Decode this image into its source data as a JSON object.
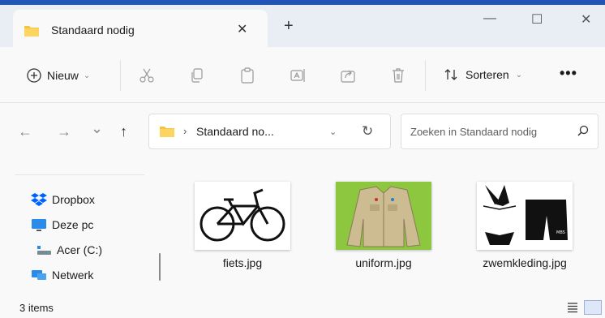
{
  "tab": {
    "title": "Standaard nodig",
    "close": "✕",
    "new_tab": "+"
  },
  "window_controls": {
    "minimize": "—",
    "maximize": "☐",
    "close": "✕"
  },
  "toolbar": {
    "new_label": "Nieuw",
    "sort_label": "Sorteren",
    "more_label": "•••",
    "icons": [
      "cut-icon",
      "copy-icon",
      "paste-icon",
      "rename-icon",
      "share-icon",
      "delete-icon"
    ]
  },
  "nav": {
    "back": "←",
    "forward": "→",
    "recent": "⌄",
    "up": "↑"
  },
  "address": {
    "separator": "›",
    "path": "Standaard no...",
    "dropdown": "⌄",
    "refresh": "↻"
  },
  "search": {
    "placeholder": "Zoeken in Standaard nodig"
  },
  "sidebar": {
    "items": [
      {
        "label": "Dropbox",
        "icon": "dropbox-icon"
      },
      {
        "label": "Deze pc",
        "icon": "computer-icon"
      },
      {
        "label": "Acer (C:)",
        "icon": "drive-icon"
      },
      {
        "label": "Netwerk",
        "icon": "network-icon"
      }
    ]
  },
  "files": [
    {
      "name": "fiets.jpg",
      "thumbnail": "bicycle-thumbnail"
    },
    {
      "name": "uniform.jpg",
      "thumbnail": "uniform-thumbnail"
    },
    {
      "name": "zwemkleding.jpg",
      "thumbnail": "swimwear-thumbnail"
    }
  ],
  "status": {
    "count": "3 items"
  },
  "colors": {
    "folder": "#f5c342",
    "accent": "#0067c0",
    "wallpaper": "#1a4ea8"
  }
}
